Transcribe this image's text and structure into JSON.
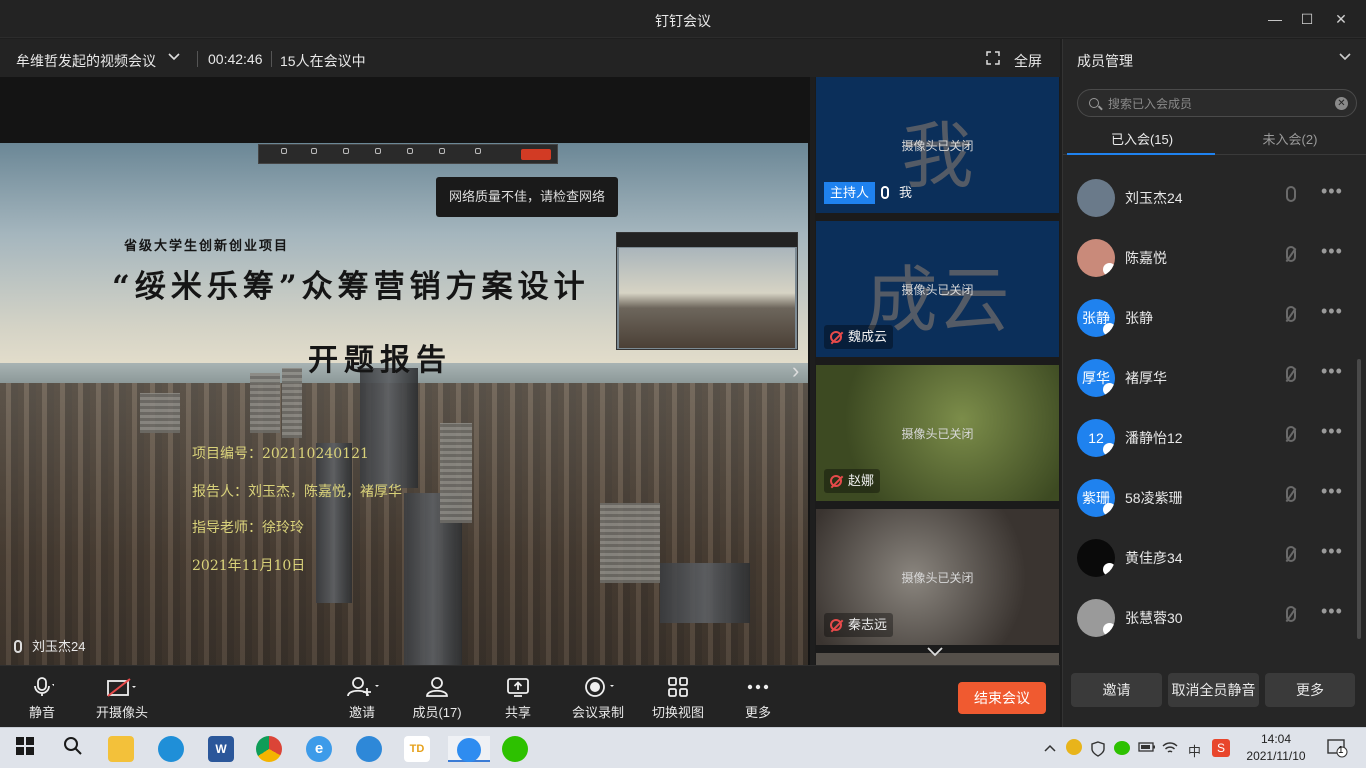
{
  "window": {
    "title": "钉钉会议",
    "minimize": "—",
    "maximize": "☐",
    "close": "✕"
  },
  "meeting": {
    "name": "牟维哲发起的视频会议",
    "duration": "00:42:46",
    "count": "15人在会议中",
    "fullscreen": "全屏"
  },
  "network_warning": "网络质量不佳，请检查网络",
  "slide": {
    "subtitle": "省级大学生创新创业项目",
    "title": "“绥米乐筹”众筹营销方案设计",
    "report": "开题报告",
    "info": [
      "项目编号：202110240121",
      "报告人：刘玉杰，陈嘉悦，褚厚华",
      "指导老师：徐玲玲",
      "2021年11月10日"
    ]
  },
  "active_speaker": "刘玉杰24",
  "thumbnails": [
    {
      "big": "我",
      "status": "摄像头已关闭",
      "badge": "主持人",
      "name": "我",
      "bg": "#0b2f5a"
    },
    {
      "big": "成云",
      "status": "摄像头已关闭",
      "name": "魏成云",
      "bg": "#0b2f5a"
    },
    {
      "big": "",
      "status": "摄像头已关闭",
      "name": "赵娜",
      "bg": "#4c5a2e"
    },
    {
      "big": "",
      "status": "摄像头已关闭",
      "name": "秦志远",
      "bg": "#4a4440"
    }
  ],
  "panel": {
    "title": "成员管理",
    "search_placeholder": "搜索已入会成员",
    "tab_joined": "已入会(15)",
    "tab_not_joined": "未入会(2)",
    "members": [
      {
        "name": "刘玉杰24",
        "avatar": "",
        "color": "#6a7a8a",
        "muted": false
      },
      {
        "name": "陈嘉悦",
        "avatar": "",
        "color": "#c98a7a",
        "muted": true
      },
      {
        "name": "张静",
        "avatar": "张静",
        "color": "#1f82ef",
        "muted": true
      },
      {
        "name": "褚厚华",
        "avatar": "厚华",
        "color": "#1f82ef",
        "muted": true
      },
      {
        "name": "潘静怡12",
        "avatar": "12",
        "color": "#1f82ef",
        "muted": true
      },
      {
        "name": "58凌紫珊",
        "avatar": "紫珊",
        "color": "#1f82ef",
        "muted": true
      },
      {
        "name": "黄佳彦34",
        "avatar": "",
        "color": "#0a0a0a",
        "muted": true
      },
      {
        "name": "张慧蓉30",
        "avatar": "",
        "color": "#9a9a9a",
        "muted": true
      }
    ],
    "more": "•••",
    "btn_invite": "邀请",
    "btn_unmute_all": "取消全员静音",
    "btn_more": "更多"
  },
  "toolbar": {
    "mute": "静音",
    "camera": "开摄像头",
    "invite": "邀请",
    "members": "成员(17)",
    "share": "共享",
    "record": "会议录制",
    "switch_view": "切换视图",
    "more": "更多",
    "end": "结束会议"
  },
  "taskbar": {
    "ime": "中",
    "time": "14:04",
    "date": "2021/11/10",
    "notif": "1"
  }
}
